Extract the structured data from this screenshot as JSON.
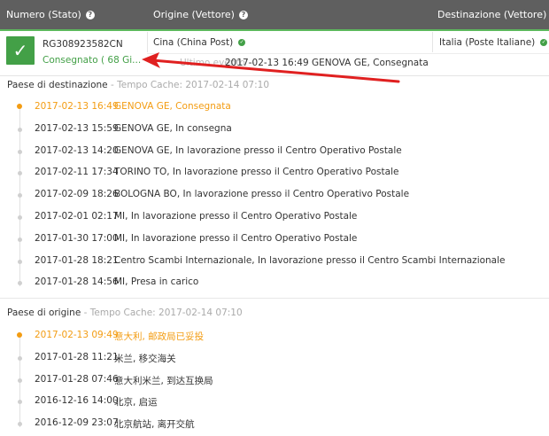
{
  "header": {
    "col_number": "Numero (Stato)",
    "col_origin": "Origine (Vettore)",
    "col_dest": "Destinazione (Vettore)",
    "help_icon": "?"
  },
  "shipment": {
    "number": "RG308923582CN",
    "status": "Consegnato ( 68 Gi...",
    "origin": "Cina (China Post)",
    "destination": "Italia (Poste Italiane)",
    "last_event_label": "Ultimo evento --",
    "last_event": "2017-02-13 16:49 GENOVA GE, Consegnata",
    "check_icon": "✓",
    "ok_icon": "✓"
  },
  "dest_section": {
    "title": "Paese di destinazione",
    "cache": " - Tempo Cache: 2017-02-14 07:10",
    "events": [
      {
        "dt": "2017-02-13 16:49",
        "desc": "GENOVA GE, Consegnata"
      },
      {
        "dt": "2017-02-13 15:59",
        "desc": "GENOVA GE, In consegna"
      },
      {
        "dt": "2017-02-13 14:20",
        "desc": "GENOVA GE, In lavorazione presso il Centro Operativo Postale"
      },
      {
        "dt": "2017-02-11 17:34",
        "desc": "TORINO TO, In lavorazione presso il Centro Operativo Postale"
      },
      {
        "dt": "2017-02-09 18:26",
        "desc": "BOLOGNA BO, In lavorazione presso il Centro Operativo Postale"
      },
      {
        "dt": "2017-02-01 02:17",
        "desc": "MI, In lavorazione presso il Centro Operativo Postale"
      },
      {
        "dt": "2017-01-30 17:00",
        "desc": "MI, In lavorazione presso il Centro Operativo Postale"
      },
      {
        "dt": "2017-01-28 18:21",
        "desc": "Centro Scambi Internazionale, In lavorazione presso il Centro Scambi Internazionale"
      },
      {
        "dt": "2017-01-28 14:56",
        "desc": "MI, Presa in carico"
      }
    ]
  },
  "origin_section": {
    "title": "Paese di origine",
    "cache": " - Tempo Cache: 2017-02-14 07:10",
    "events": [
      {
        "dt": "2017-02-13 09:49",
        "desc": "意大利, 邮政局已妥投"
      },
      {
        "dt": "2017-01-28 11:21",
        "desc": "米兰, 移交海关"
      },
      {
        "dt": "2017-01-28 07:46",
        "desc": "意大利米兰, 到达互换局"
      },
      {
        "dt": "2016-12-16 14:00",
        "desc": "北京, 启运"
      },
      {
        "dt": "2016-12-09 23:07",
        "desc": "北京航站, 离开交航"
      }
    ]
  },
  "colors": {
    "accent_green": "#43a047",
    "highlight_orange": "#f39c12",
    "header_bg": "#5f5f5f",
    "arrow_red": "#e02020"
  }
}
